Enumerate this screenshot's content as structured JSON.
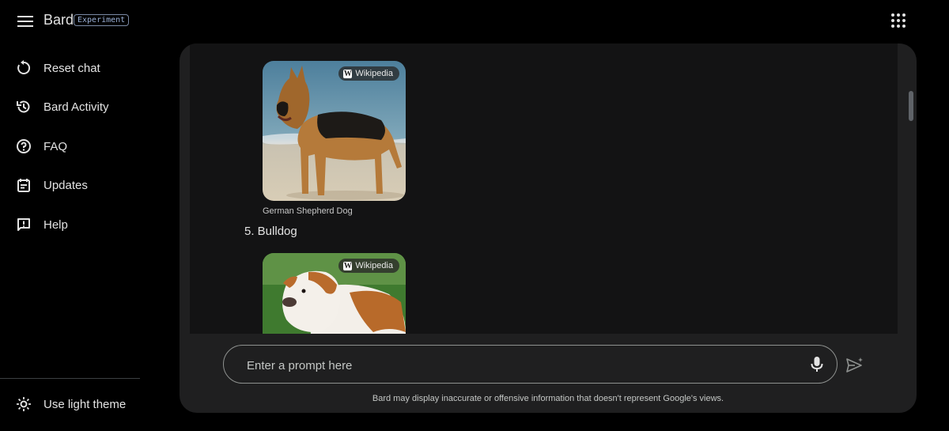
{
  "header": {
    "app_name": "Bard",
    "badge": "Experiment"
  },
  "sidebar": {
    "items": [
      {
        "label": "Reset chat",
        "icon": "reset-icon"
      },
      {
        "label": "Bard Activity",
        "icon": "history-icon"
      },
      {
        "label": "FAQ",
        "icon": "help-circle-icon"
      },
      {
        "label": "Updates",
        "icon": "calendar-icon"
      },
      {
        "label": "Help",
        "icon": "feedback-icon"
      }
    ],
    "theme_toggle": {
      "label": "Use light theme",
      "icon": "sun-icon"
    }
  },
  "chat": {
    "images": [
      {
        "source_label": "Wikipedia",
        "caption": "German Shepherd Dog"
      },
      {
        "source_label": "Wikipedia"
      }
    ],
    "list_item": "5. Bulldog"
  },
  "prompt": {
    "placeholder": "Enter a prompt here"
  },
  "disclaimer": "Bard may display inaccurate or offensive information that doesn't represent Google's views."
}
